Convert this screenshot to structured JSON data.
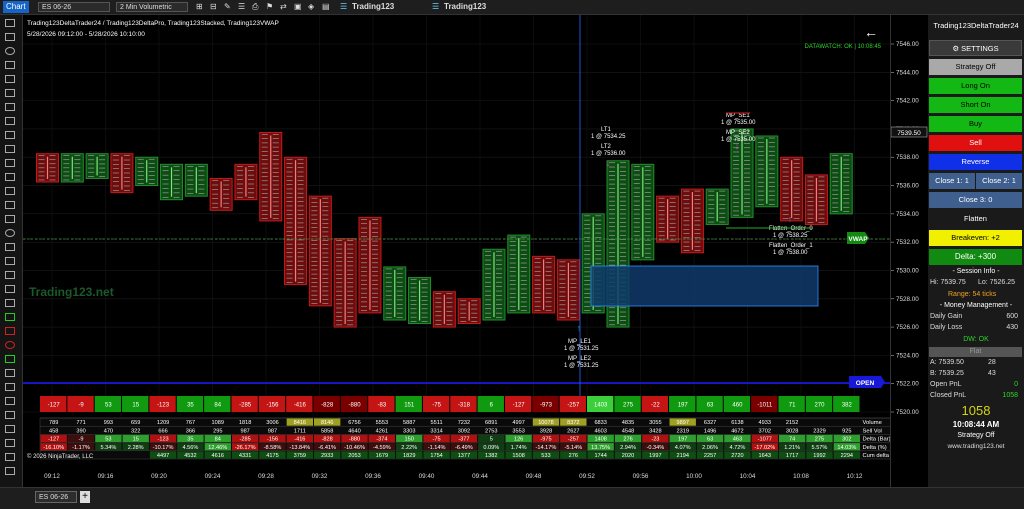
{
  "topbar": {
    "chart_label": "Chart",
    "instrument": "ES 06-26",
    "timeframe": "2 Min Volumetric",
    "brand1": "Trading123",
    "brand2": "Trading123"
  },
  "chart": {
    "title": "Trading123DeltaTrader24 / Trading123DeltaPro, Trading123Stacked, Trading123VWAP",
    "date_range": "5/28/2026 09:12:00 - 5/28/2026 10:10:00",
    "datawatch": "DATAWATCH: OK | 10:08:45",
    "watermark": "Trading123.net",
    "copyright": "© 2026 NinjaTrader, LLC",
    "vwap_label": "VWAP",
    "open_label": "OPEN",
    "last_price_tag": "7539.50",
    "annotations": {
      "lt1": "LT1",
      "lt1_fill": "1 @ 7534.25",
      "lt2": "LT2",
      "lt2_fill": "1 @ 7536.00",
      "mp_se1": "MP_SE1",
      "mp_se1_fill": "1 @ 7535.00",
      "mp_se2": "MP_SE2",
      "mp_se2_fill": "1 @ 7535.00",
      "flatten0": "Flatten_Order_0",
      "flatten0_fill": "1 @ 7538.25",
      "flatten1": "Flatten_Order_1",
      "flatten1_fill": "1 @ 7538.00",
      "mp_le1": "MP_LE1",
      "mp_le1_fill": "1 @ 7531.25",
      "mp_le2": "MP_LE2",
      "mp_le2_fill": "1 @ 7531.25"
    },
    "y_ticks": [
      "7546.00",
      "7544.00",
      "7542.00",
      "7540.00",
      "7538.00",
      "7536.00",
      "7534.00",
      "7532.00",
      "7530.00",
      "7528.00",
      "7526.00",
      "7524.00",
      "7522.00",
      "7520.00"
    ],
    "x_ticks": [
      "09:12",
      "09:16",
      "09:20",
      "09:24",
      "09:28",
      "09:32",
      "09:36",
      "09:40",
      "09:44",
      "09:48",
      "09:52",
      "09:56",
      "10:00",
      "10:04",
      "10:08",
      "10:12"
    ],
    "delta_strip": [
      "-127",
      "-9",
      "53",
      "15",
      "-123",
      "35",
      "84",
      "-285",
      "-156",
      "-416",
      "-828",
      "-880",
      "-83",
      "151",
      "-75",
      "-318",
      "6",
      "-127",
      "-973",
      "-257",
      "1403",
      "275",
      "-22",
      "197",
      "63",
      "460",
      "-1011",
      "71",
      "270",
      "382"
    ],
    "table_labels": [
      "Volume",
      "Sell Vol",
      "Delta (Bar)",
      "Delta (%)",
      "Cum delta"
    ],
    "table_rows": [
      [
        "789",
        "771",
        "993",
        "659",
        "1209",
        "767",
        "1089",
        "1818",
        "3006",
        "8416",
        "8146",
        "6756",
        "5553",
        "5887",
        "5511",
        "7232",
        "6891",
        "4997",
        "10078",
        "8372",
        "6833",
        "4835",
        "3055",
        "9897",
        "6327",
        "6138",
        "4933",
        "2152"
      ],
      [
        "458",
        "390",
        "470",
        "322",
        "666",
        "366",
        "295",
        "987",
        "987",
        "1711",
        "5858",
        "4640",
        "4261",
        "3303",
        "3314",
        "3092",
        "2753",
        "3553",
        "3928",
        "2627",
        "4603",
        "4548",
        "3428",
        "2319",
        "1496",
        "4672",
        "3702",
        "3028",
        "2329",
        "925"
      ],
      [
        "-127",
        "-9",
        "53",
        "15",
        "-123",
        "35",
        "84",
        "-285",
        "-156",
        "-416",
        "-828",
        "-880",
        "-374",
        "150",
        "-75",
        "-377",
        "5",
        "126",
        "-975",
        "-257",
        "1408",
        "276",
        "-23",
        "197",
        "63",
        "463",
        "-1077",
        "74",
        "275",
        "302"
      ],
      [
        "-16.10%",
        "-1.17%",
        "5.34%",
        "2.28%",
        "-10.17%",
        "4.56%",
        "12.46%",
        "-26.17%",
        "-8.58%",
        "-13.84%",
        "-6.41%",
        "-10.46%",
        "-4.59%",
        "2.22%",
        "-1.14%",
        "-6.49%",
        "0.09%",
        "1.74%",
        "-14.17%",
        "-5.14%",
        "13.75%",
        "2.94%",
        "-0.34%",
        "4.07%",
        "2.06%",
        "4.72%",
        "-17.02%",
        "1.21%",
        "5.57%",
        "14.03%"
      ],
      [
        "",
        "",
        "",
        "",
        "4497",
        "4532",
        "4616",
        "4331",
        "4175",
        "3759",
        "2933",
        "2053",
        "1679",
        "1829",
        "1754",
        "1377",
        "1382",
        "1508",
        "533",
        "276",
        "1744",
        "2020",
        "1997",
        "2194",
        "2257",
        "2720",
        "1643",
        "1717",
        "1992",
        "2294"
      ]
    ]
  },
  "panel": {
    "title": "Trading123DeltaTrader24",
    "settings": "SETTINGS",
    "strategy_off": "Strategy Off",
    "long_on": "Long On",
    "short_on": "Short On",
    "buy": "Buy",
    "sell": "Sell",
    "reverse": "Reverse",
    "close1": "Close 1: 1",
    "close2": "Close 2: 1",
    "close3": "Close 3: 0",
    "flatten": "Flatten",
    "breakeven": "Breakeven: +2",
    "delta": "Delta: +300",
    "session_info": "Session Info",
    "hi": "Hi: 7539.75",
    "lo": "Lo: 7526.25",
    "range": "Range: 54 ticks",
    "money_mgmt": "Money Management",
    "daily_gain_label": "Daily Gain",
    "daily_gain": "600",
    "daily_loss_label": "Daily Loss",
    "daily_loss": "430",
    "dw": "DW: OK",
    "flat": "Flat",
    "ask_label": "A: 7539.50",
    "ask_size": "28",
    "bid_label": "B: 7539.25",
    "bid_size": "43",
    "open_pnl_label": "Open PnL",
    "open_pnl": "0",
    "closed_pnl_label": "Closed PnL",
    "closed_pnl": "1058",
    "big_pnl": "1058",
    "clock": "10:08:44 AM",
    "strategy_state": "Strategy Off",
    "website": "www.trading123.net"
  },
  "tabs": {
    "active": "ES 06-26",
    "add": "+"
  },
  "colors": {
    "up": "#1f8f2a",
    "down": "#c81818",
    "vwap": "#118a11",
    "open": "#1818d8",
    "panel_green": "#14b814",
    "panel_red": "#e01010",
    "panel_blue": "#1030e8",
    "breakeven_yellow": "#f0f000",
    "gain_gold": "#d4d414"
  }
}
